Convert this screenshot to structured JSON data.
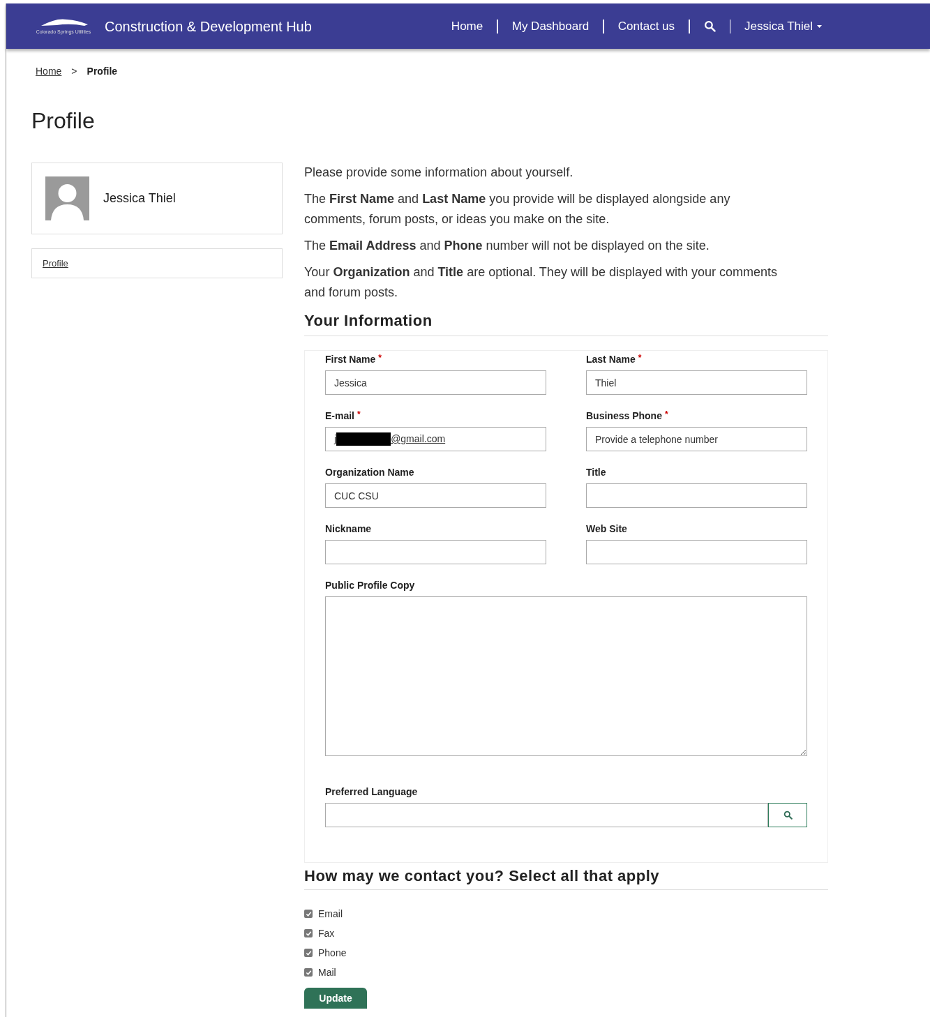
{
  "header": {
    "logo_text": "Colorado Springs Utilities",
    "title": "Construction & Development Hub",
    "nav": [
      "Home",
      "My Dashboard",
      "Contact us"
    ],
    "user": "Jessica Thiel"
  },
  "breadcrumb": {
    "links": [
      "Home"
    ],
    "separator": ">",
    "current": "Profile"
  },
  "page_title": "Profile",
  "sidebar": {
    "user_name": "Jessica Thiel",
    "links": [
      "Profile"
    ]
  },
  "intro": [
    "Please provide some information about yourself.",
    "The **First Name** and **Last Name** you provide will be displayed alongside any comments, forum posts, or ideas you make on the site.",
    "The **Email Address** and **Phone** number will not be displayed on the site.",
    "Your **Organization** and **Title** are optional. They will be displayed with your comments and forum posts."
  ],
  "info_heading": "Your Information",
  "fields": [
    {
      "kind": "text",
      "label": "First Name",
      "required_mark": "*",
      "value": "Jessica"
    },
    {
      "kind": "text",
      "label": "Last Name",
      "required_mark": "*",
      "value": "Thiel"
    },
    {
      "kind": "email",
      "label": "E-mail",
      "required_mark": "*",
      "value_start": "j",
      "value_end": "@gmail.com"
    },
    {
      "kind": "text",
      "label": "Business Phone",
      "required_mark": "*",
      "placeholder": "Provide a telephone number"
    },
    {
      "kind": "text",
      "label": "Organization Name",
      "value": "CUC CSU"
    },
    {
      "kind": "text",
      "label": "Title"
    },
    {
      "kind": "text",
      "label": "Nickname"
    },
    {
      "kind": "text",
      "label": "Web Site"
    },
    {
      "kind": "textarea",
      "label": "Public Profile Copy"
    },
    {
      "kind": "lookup",
      "label": "Preferred Language"
    }
  ],
  "contact_heading": "How may we contact you? Select all that apply",
  "contact_options": [
    {
      "label": "Email",
      "checked": true
    },
    {
      "label": "Fax",
      "checked": true
    },
    {
      "label": "Phone",
      "checked": true
    },
    {
      "label": "Mail",
      "checked": true
    }
  ],
  "update_button": "Update"
}
